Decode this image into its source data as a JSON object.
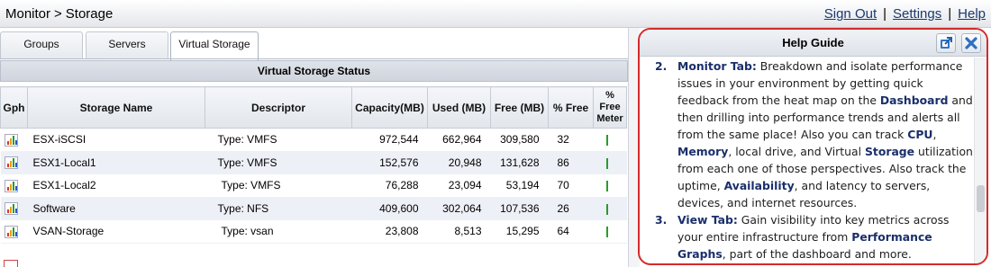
{
  "breadcrumb": {
    "section": "Monitor",
    "separator": ">",
    "page": "Storage"
  },
  "top_links": {
    "sign_out": "Sign Out",
    "settings": "Settings",
    "help": "Help",
    "separator": "|"
  },
  "tabs": [
    {
      "label": "Groups",
      "active": false
    },
    {
      "label": "Servers",
      "active": false
    },
    {
      "label": "Virtual Storage",
      "active": true
    }
  ],
  "panel": {
    "title": "Virtual Storage Status"
  },
  "table": {
    "columns": [
      "Gph",
      "Storage Name",
      "Descriptor",
      "Capacity(MB)",
      "Used (MB)",
      "Free (MB)",
      "% Free",
      "% Free Meter"
    ],
    "rows": [
      {
        "name": "ESX-iSCSI",
        "descriptor": "Type: VMFS",
        "capacity": "972,544",
        "used": "662,964",
        "free": "309,580",
        "pct_free": "32"
      },
      {
        "name": "ESX1-Local1",
        "descriptor": "Type: VMFS",
        "capacity": "152,576",
        "used": "20,948",
        "free": "131,628",
        "pct_free": "86"
      },
      {
        "name": "ESX1-Local2",
        "descriptor": "Type: VMFS",
        "capacity": "76,288",
        "used": "23,094",
        "free": "53,194",
        "pct_free": "70"
      },
      {
        "name": "Software",
        "descriptor": "Type: NFS",
        "capacity": "409,600",
        "used": "302,064",
        "free": "107,536",
        "pct_free": "26"
      },
      {
        "name": "VSAN-Storage",
        "descriptor": "Type: vsan",
        "capacity": "23,808",
        "used": "8,513",
        "free": "15,295",
        "pct_free": "64"
      }
    ]
  },
  "help": {
    "title": "Help Guide",
    "item2": {
      "number": "2.",
      "p1": "Monitor Tab:",
      "p2": " Breakdown and isolate performance issues in your environment by getting quick feedback from the heat map on the ",
      "p3": "Dashboard",
      "p4": " and then drilling into performance trends and alerts all from the same place! Also you can track ",
      "p5": "CPU",
      "p6": ", ",
      "p7": "Memory",
      "p8": ", local drive, and Virtual ",
      "p9": "Storage",
      "p10": " utilization from each one of those perspectives.  Also track the uptime, ",
      "p11": "Availability",
      "p12": ", and latency to servers, devices, and internet resources."
    },
    "item3": {
      "number": "3.",
      "p1": "View Tab:",
      "p2": " Gain visibility into key metrics across your entire infrastructure from ",
      "p3": "Performance Graphs",
      "p4": ", part of the dashboard and more."
    }
  },
  "colors": {
    "accent_border": "#d52a2a",
    "help_link_text": "#1a2f6b",
    "meter": "#2a9a2a"
  },
  "icons": [
    "graph-icon",
    "popout-icon",
    "close-icon"
  ]
}
